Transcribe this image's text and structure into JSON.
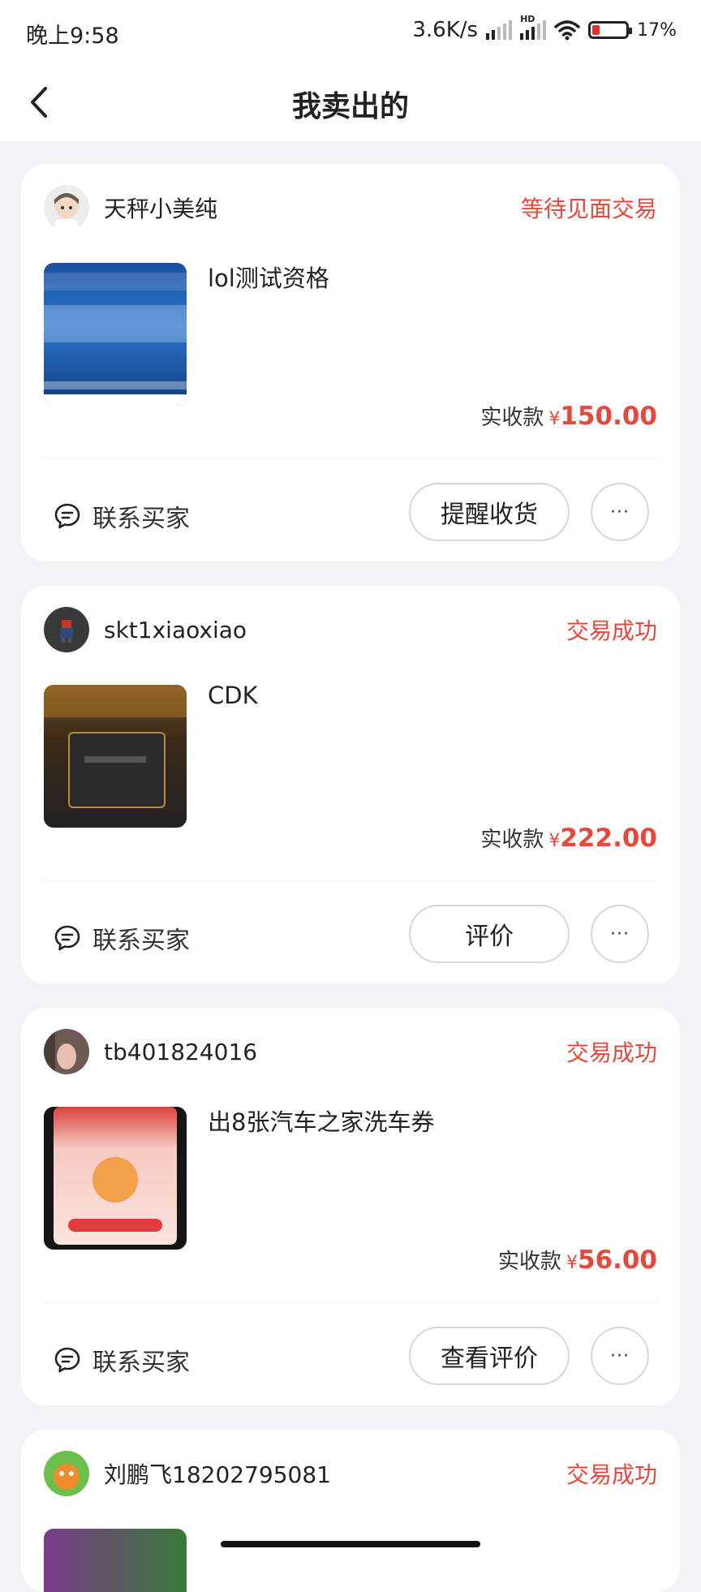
{
  "status_bar": {
    "time": "晚上9:58",
    "speed": "3.6K/s",
    "hd": "HD",
    "battery": "17%"
  },
  "nav": {
    "title": "我卖出的"
  },
  "orders": [
    {
      "seller": "天秤小美纯",
      "status": "等待见面交易",
      "title": "lol测试资格",
      "price_label": "实收款",
      "currency": "¥",
      "price": "150.00",
      "contact": "联系买家",
      "action": "提醒收货",
      "more": "···"
    },
    {
      "seller": "skt1xiaoxiao",
      "status": "交易成功",
      "title": "CDK",
      "price_label": "实收款",
      "currency": "¥",
      "price": "222.00",
      "contact": "联系买家",
      "action": "评价",
      "more": "···"
    },
    {
      "seller": "tb401824016",
      "status": "交易成功",
      "title": "出8张汽车之家洗车券",
      "price_label": "实收款",
      "currency": "¥",
      "price": "56.00",
      "contact": "联系买家",
      "action": "查看评价",
      "more": "···"
    },
    {
      "seller": "刘鹏飞18202795081",
      "status": "交易成功"
    }
  ],
  "colors": {
    "status_red": "#e8483b",
    "background": "#f2f3f5"
  }
}
